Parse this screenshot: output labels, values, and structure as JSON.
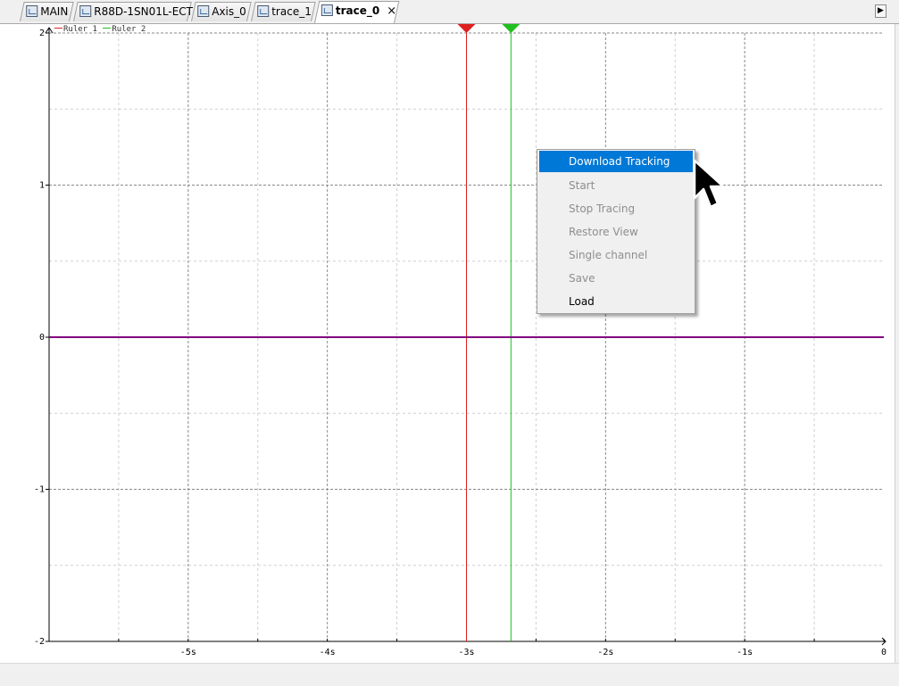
{
  "tabs": [
    {
      "label": "MAIN",
      "icon": "program-icon"
    },
    {
      "label": "R88D-1SN01L-ECT",
      "icon": "device-icon"
    },
    {
      "label": "Axis_0",
      "icon": "axis-icon"
    },
    {
      "label": "trace_1",
      "icon": "trace-icon"
    },
    {
      "label": "trace_0",
      "icon": "trace-icon",
      "active": true,
      "close": "×"
    }
  ],
  "tab_scroll": "▶",
  "legend": {
    "ruler1": "Ruler 1",
    "ruler2": "Ruler 2"
  },
  "context_menu": [
    {
      "label": "Download Tracking",
      "enabled": true,
      "highlighted": true
    },
    {
      "label": "Start",
      "enabled": false
    },
    {
      "label": "Stop Tracing",
      "enabled": false
    },
    {
      "label": "Restore View",
      "enabled": false
    },
    {
      "label": "Single channel",
      "enabled": false
    },
    {
      "label": "Save",
      "enabled": false
    },
    {
      "label": "Load",
      "enabled": true
    }
  ],
  "colors": {
    "ruler1": "#e02020",
    "ruler2": "#20c020",
    "signal": "#800080",
    "menu_highlight": "#0078d7"
  },
  "chart_data": {
    "type": "line",
    "x_ticks": [
      "-5s",
      "-4s",
      "-3s",
      "-2s",
      "-1s",
      "0"
    ],
    "x_tick_values": [
      -5,
      -4,
      -3,
      -2,
      -1,
      0
    ],
    "y_ticks": [
      "-2",
      "-1",
      "0",
      "1",
      "2"
    ],
    "y_tick_values": [
      -2,
      -1,
      0,
      1,
      2
    ],
    "xlim": [
      -6.0,
      0
    ],
    "ylim": [
      -2,
      2
    ],
    "grid": true,
    "series": [
      {
        "x": [
          -6.0,
          0
        ],
        "y": [
          0,
          0
        ]
      }
    ],
    "rulers": [
      {
        "name": "Ruler 1",
        "x": -3.0
      },
      {
        "name": "Ruler 2",
        "x": -2.68
      }
    ]
  }
}
